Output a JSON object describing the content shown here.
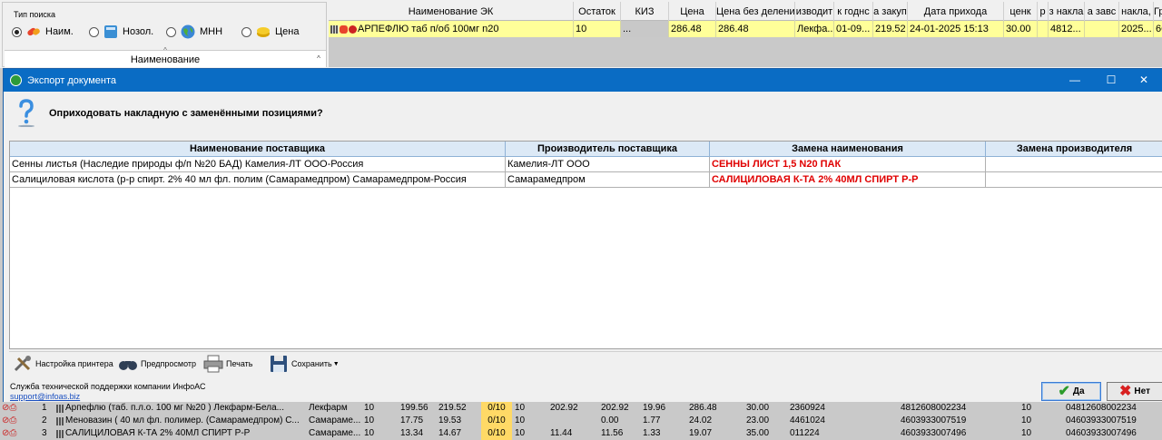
{
  "search": {
    "type_label": "Тип поиска",
    "options": [
      {
        "label": "Наим.",
        "selected": true,
        "icon": "pills-icon"
      },
      {
        "label": "Нозол.",
        "selected": false,
        "icon": "book-icon"
      },
      {
        "label": "МНН",
        "selected": false,
        "icon": "globe-icon"
      },
      {
        "label": "Цена",
        "selected": false,
        "icon": "coins-icon"
      }
    ],
    "name_header": "Наименование"
  },
  "top_grid": {
    "columns": [
      "Наименование ЭК",
      "Остаток",
      "КИЗ",
      "Цена",
      "Цена без делени",
      "изводит",
      "к годнс",
      "а закуп",
      "Дата прихода",
      "ценк",
      "р",
      "з накла",
      "а завс",
      "накла,",
      "Гр"
    ],
    "row": [
      "АРПЕФЛЮ таб п/об 100мг n20",
      "10",
      "...",
      "286.48",
      "286.48",
      "Лекфа...",
      "01-09...",
      "219.52",
      "24-01-2025 15:13",
      "30.00",
      "",
      "4812...",
      "",
      "2025...",
      "66"
    ]
  },
  "dialog": {
    "title": "Экспорт документа",
    "question": "Оприходовать накладную с заменёнными позициями?",
    "window_controls": {
      "minimize": "—",
      "maximize": "☐",
      "close": "✕"
    },
    "columns": [
      "Наименование поставщика",
      "Производитель поставщика",
      "Замена наименования",
      "Замена производителя"
    ],
    "rows": [
      [
        "Сенны листья (Наследие природы ф/п №20 БАД) Камелия-ЛТ ООО-Россия",
        "Камелия-ЛТ ООО",
        "СЕННЫ ЛИСТ 1,5 N20 ПАК",
        ""
      ],
      [
        "Салициловая кислота (р-р спирт. 2% 40 мл фл. полим (Самарамедпром) Самарамедпром-Россия",
        "Самарамедпром",
        "САЛИЦИЛОВАЯ К-ТА 2% 40МЛ СПИРТ Р-Р",
        ""
      ]
    ],
    "toolbar": {
      "printer_settings": "Настройка принтера",
      "preview": "Предпросмотр",
      "print": "Печать",
      "save": "Сохранить"
    },
    "support_label": "Служба технической поддержки компании ИнфоАС",
    "support_email": "support@infoas.biz",
    "yes_label": "Да",
    "no_label": "Нет"
  },
  "bottom_grid": {
    "rows": [
      [
        "1",
        "Арпефлю (таб. п.л.о. 100 мг №20 ) Лекфарм-Бела...",
        "Лекфарм",
        "10",
        "199.56",
        "219.52",
        "0/10",
        "10",
        "202.92",
        "202.92",
        "19.96",
        "286.48",
        "30.00",
        "2360924",
        "4812608002234",
        "10",
        "04812608002234"
      ],
      [
        "2",
        "Меновазин ( 40 мл фл. полимер. (Самарамедпром) С...",
        "Самараме...",
        "10",
        "17.75",
        "19.53",
        "0/10",
        "10",
        "",
        "0.00",
        "1.77",
        "24.02",
        "23.00",
        "4461024",
        "4603933007519",
        "10",
        "04603933007519"
      ],
      [
        "3",
        "САЛИЦИЛОВАЯ К-ТА 2% 40МЛ СПИРТ Р-Р",
        "Самараме...",
        "10",
        "13.34",
        "14.67",
        "0/10",
        "10",
        "11.44",
        "11.56",
        "1.33",
        "19.07",
        "35.00",
        "011224",
        "4603933007496",
        "10",
        "04603933007496"
      ]
    ]
  }
}
